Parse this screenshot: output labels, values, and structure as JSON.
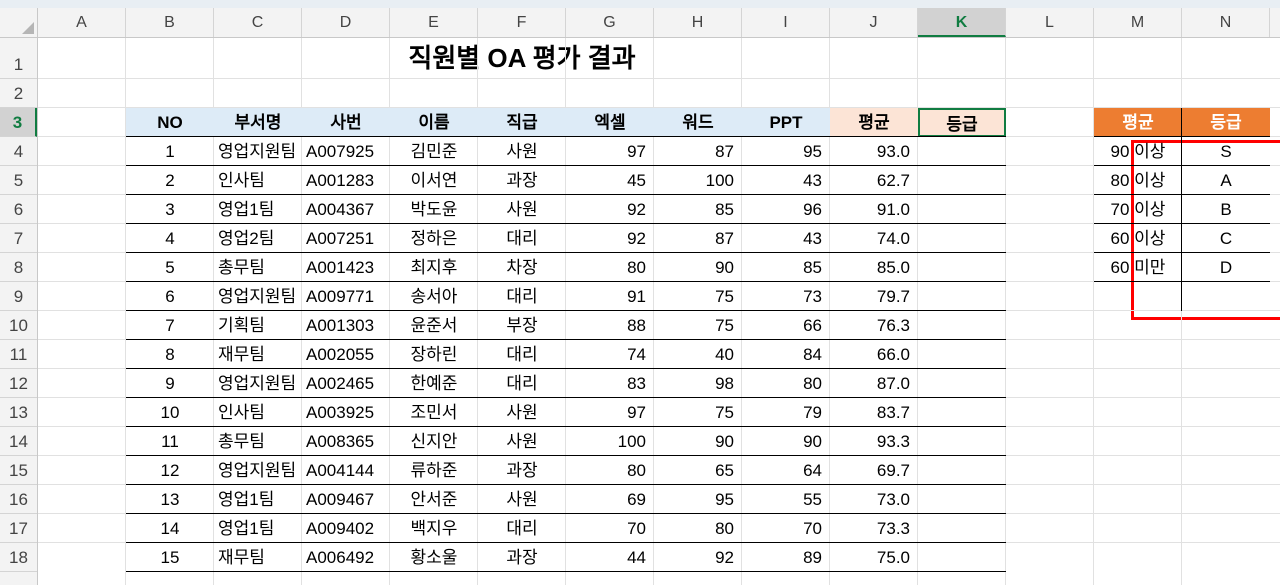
{
  "columns": [
    "A",
    "B",
    "C",
    "D",
    "E",
    "F",
    "G",
    "H",
    "I",
    "J",
    "K",
    "L",
    "M",
    "N"
  ],
  "selected_column": "K",
  "rows": [
    "1",
    "2",
    "3",
    "4",
    "5",
    "6",
    "7",
    "8",
    "9",
    "10",
    "11",
    "12",
    "13",
    "14",
    "15",
    "16",
    "17",
    "18"
  ],
  "selected_row": "3",
  "title": "직원별 OA 평가 결과",
  "table": {
    "headers": [
      "NO",
      "부서명",
      "사번",
      "이름",
      "직급",
      "엑셀",
      "워드",
      "PPT",
      "평균",
      "등급"
    ],
    "rows": [
      [
        "1",
        "영업지원팀",
        "A007925",
        "김민준",
        "사원",
        "97",
        "87",
        "95",
        "93.0",
        ""
      ],
      [
        "2",
        "인사팀",
        "A001283",
        "이서연",
        "과장",
        "45",
        "100",
        "43",
        "62.7",
        ""
      ],
      [
        "3",
        "영업1팀",
        "A004367",
        "박도윤",
        "사원",
        "92",
        "85",
        "96",
        "91.0",
        ""
      ],
      [
        "4",
        "영업2팀",
        "A007251",
        "정하은",
        "대리",
        "92",
        "87",
        "43",
        "74.0",
        ""
      ],
      [
        "5",
        "총무팀",
        "A001423",
        "최지후",
        "차장",
        "80",
        "90",
        "85",
        "85.0",
        ""
      ],
      [
        "6",
        "영업지원팀",
        "A009771",
        "송서아",
        "대리",
        "91",
        "75",
        "73",
        "79.7",
        ""
      ],
      [
        "7",
        "기획팀",
        "A001303",
        "윤준서",
        "부장",
        "88",
        "75",
        "66",
        "76.3",
        ""
      ],
      [
        "8",
        "재무팀",
        "A002055",
        "장하린",
        "대리",
        "74",
        "40",
        "84",
        "66.0",
        ""
      ],
      [
        "9",
        "영업지원팀",
        "A002465",
        "한예준",
        "대리",
        "83",
        "98",
        "80",
        "87.0",
        ""
      ],
      [
        "10",
        "인사팀",
        "A003925",
        "조민서",
        "사원",
        "97",
        "75",
        "79",
        "83.7",
        ""
      ],
      [
        "11",
        "총무팀",
        "A008365",
        "신지안",
        "사원",
        "100",
        "90",
        "90",
        "93.3",
        ""
      ],
      [
        "12",
        "영업지원팀",
        "A004144",
        "류하준",
        "과장",
        "80",
        "65",
        "64",
        "69.7",
        ""
      ],
      [
        "13",
        "영업1팀",
        "A009467",
        "안서준",
        "사원",
        "69",
        "95",
        "55",
        "73.0",
        ""
      ],
      [
        "14",
        "영업1팀",
        "A009402",
        "백지우",
        "대리",
        "70",
        "80",
        "70",
        "73.3",
        ""
      ],
      [
        "15",
        "재무팀",
        "A006492",
        "황소울",
        "과장",
        "44",
        "92",
        "89",
        "75.0",
        ""
      ]
    ]
  },
  "grade_table": {
    "headers": [
      "평균",
      "등급"
    ],
    "rows": [
      [
        "90 이상",
        "S"
      ],
      [
        "80 이상",
        "A"
      ],
      [
        "70 이상",
        "B"
      ],
      [
        "60 이상",
        "C"
      ],
      [
        "60 미만",
        "D"
      ]
    ]
  },
  "colors": {
    "header_fill": "#ddebf7",
    "avg_header_fill": "#fce4d6",
    "grade_table_header_fill": "#ed7d31",
    "highlight_border": "#ff0000",
    "selection": "#107c41"
  }
}
